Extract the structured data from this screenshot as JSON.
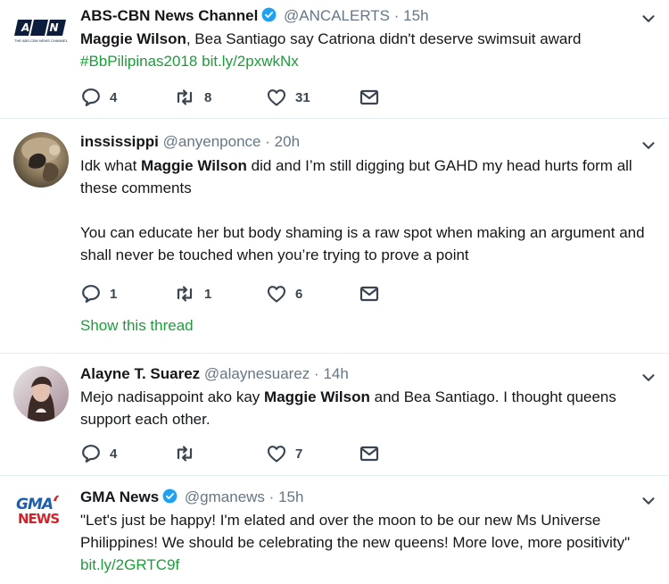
{
  "tweets": [
    {
      "name": "ABS-CBN News Channel",
      "handle": "@ANCALERTS",
      "dot": "·",
      "time": "15h",
      "verified": true,
      "avatar_text": "A N C",
      "avatar_sub": "THE ABS-CBN NEWS CHANNEL",
      "body": {
        "bold1": "Maggie Wilson",
        "text1": ", Bea Santiago say Catriona didn't deserve swimsuit award",
        "hashtag": "#BbPilipinas2018",
        "link": "bit.ly/2pxwkNx"
      },
      "replies": "4",
      "retweets": "8",
      "likes": "31"
    },
    {
      "name": "inssissippi",
      "handle": "@anyenponce",
      "dot": "·",
      "time": "20h",
      "verified": false,
      "body": {
        "text1": "Idk what ",
        "bold1": "Maggie Wilson",
        "text2": " did and I’m still digging but GAHD my head hurts form all these comments",
        "para2": "You can educate her but body shaming is a raw spot when making an argument and shall never be touched when you’re trying to prove a point"
      },
      "replies": "1",
      "retweets": "1",
      "likes": "6",
      "show_thread": "Show this thread"
    },
    {
      "name": "Alayne T. Suarez",
      "handle": "@alaynesuarez",
      "dot": "·",
      "time": "14h",
      "verified": false,
      "body": {
        "text1": "Mejo nadisappoint ako kay ",
        "bold1": "Maggie Wilson",
        "text2": " and Bea Santiago. I thought queens support each other."
      },
      "replies": "4",
      "retweets": "",
      "likes": "7"
    },
    {
      "name": "GMA News",
      "handle": "@gmanews",
      "dot": "·",
      "time": "15h",
      "verified": true,
      "avatar_line1": "GMA",
      "avatar_line2": "NEWS",
      "body": {
        "text1": "\"Let's just be happy! I'm elated and over the moon to be our new Ms Universe Philippines! We should be celebrating the new queens! More love, more positivity\" ",
        "link": "bit.ly/2GRTC9f"
      }
    }
  ],
  "colors": {
    "link": "#1b9e3a",
    "verified": "#1da1f2",
    "muted": "#657786",
    "divider": "#e6ecf0",
    "icon": "#3a4550"
  }
}
